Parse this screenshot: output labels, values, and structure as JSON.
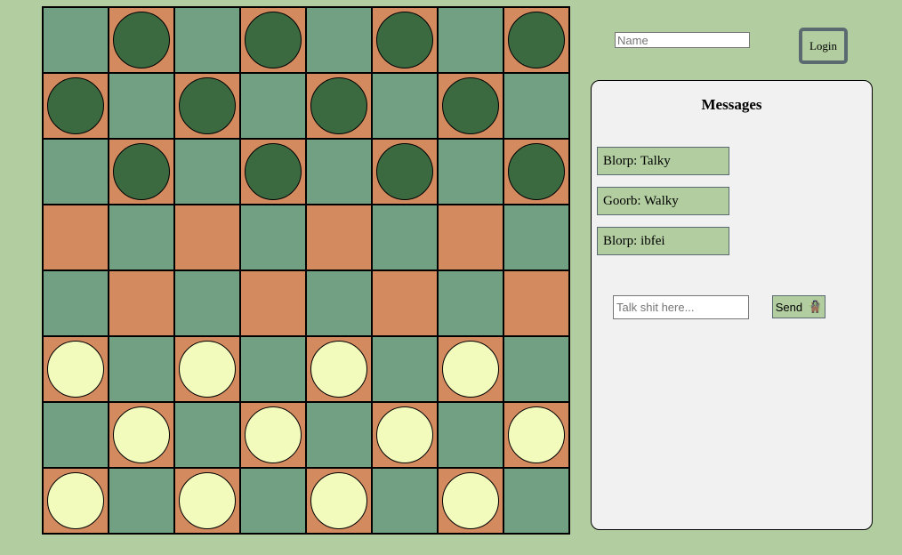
{
  "login": {
    "name_placeholder": "Name",
    "name_value": "",
    "button_label": "Login"
  },
  "board": {
    "rows": 8,
    "cols": 8,
    "colors": {
      "light_square": "#72a083",
      "dark_square": "#d38a5e",
      "dark_piece": "#3b6a41",
      "light_piece": "#f3fbbc"
    },
    "grid": [
      "-d-d-d-d",
      "d-d-d-d-",
      "-d-d-d-d",
      "--------",
      "--------",
      "l-l-l-l-",
      "-l-l-l-l",
      "l-l-l-l-"
    ]
  },
  "messages": {
    "title": "Messages",
    "items": [
      {
        "text": "Blorp: Talky"
      },
      {
        "text": "Goorb: Walky"
      },
      {
        "text": "Blorp: ibfei"
      }
    ],
    "input_placeholder": "Talk shit here...",
    "input_value": "",
    "send_label": "Send",
    "send_icon": "🧌"
  }
}
